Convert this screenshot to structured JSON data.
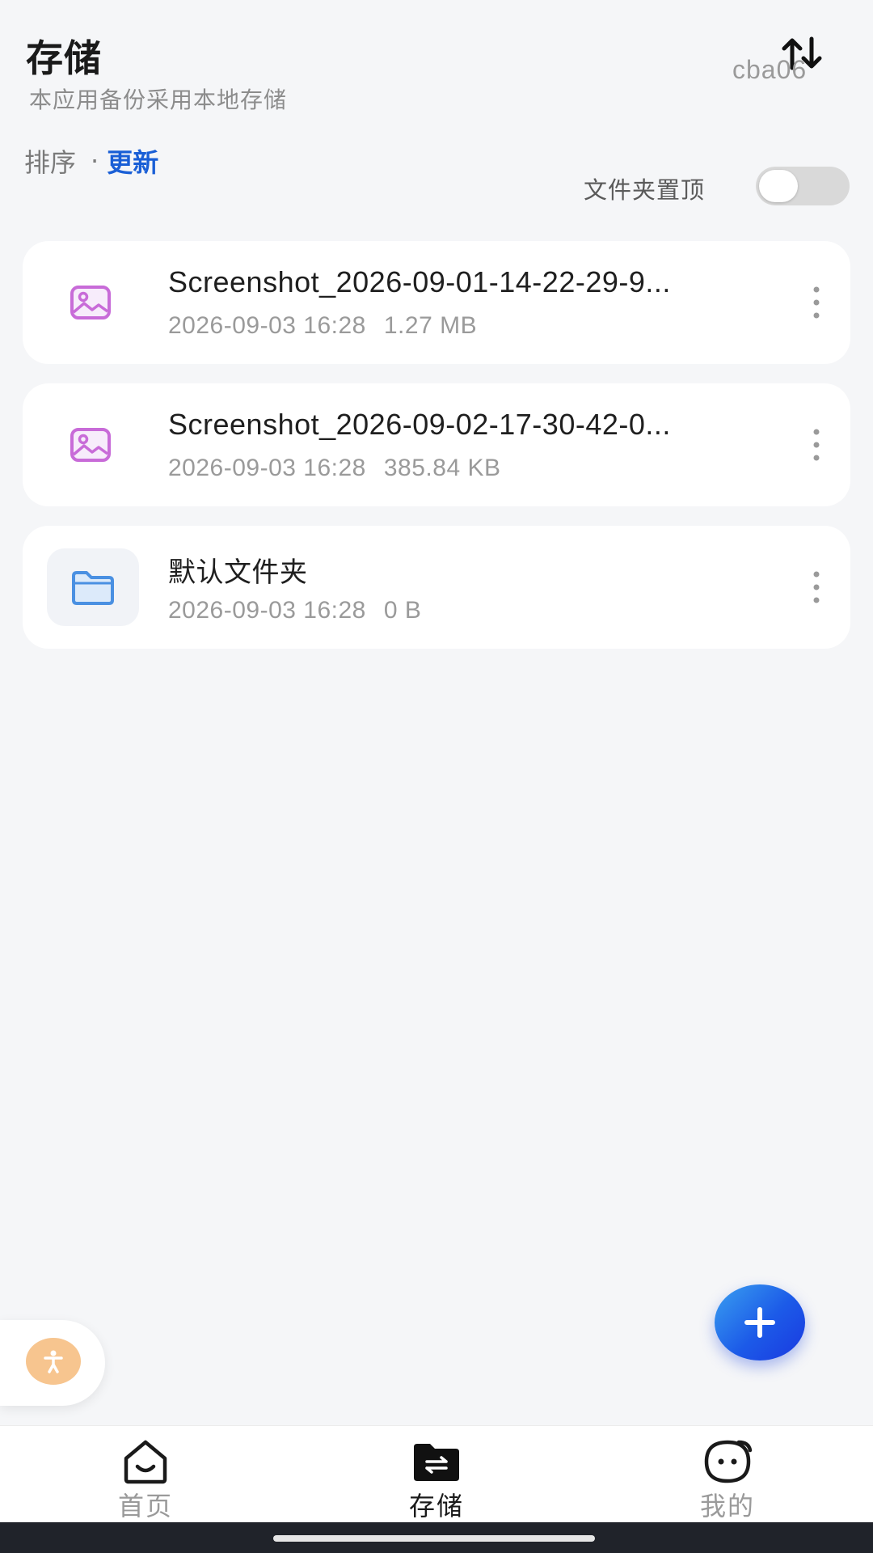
{
  "header": {
    "title": "存储",
    "subtitle": "本应用备份采用本地存储",
    "user_id": "cba06"
  },
  "sort": {
    "label": "排序",
    "separator": "·",
    "value": "更新"
  },
  "pin_folders": {
    "label": "文件夹置顶",
    "enabled": false
  },
  "files": [
    {
      "type": "image",
      "name": "Screenshot_2026-09-01-14-22-29-9...",
      "date": "2026-09-03 16:28",
      "size": "1.27 MB"
    },
    {
      "type": "image",
      "name": "Screenshot_2026-09-02-17-30-42-0...",
      "date": "2026-09-03 16:28",
      "size": "385.84 KB"
    },
    {
      "type": "folder",
      "name": "默认文件夹",
      "date": "2026-09-03 16:28",
      "size": "0 B"
    }
  ],
  "tabs": [
    {
      "label": "首页",
      "icon": "home-smile-icon"
    },
    {
      "label": "存储",
      "icon": "storage-folder-icon",
      "active": true
    },
    {
      "label": "我的",
      "icon": "profile-face-icon"
    }
  ],
  "colors": {
    "accent": "#1a5fd6",
    "fab_gradient_start": "#3aa0f0",
    "fab_gradient_end": "#1a39e0",
    "image_icon": "#c86bd8",
    "folder_icon": "#4a90e2"
  }
}
